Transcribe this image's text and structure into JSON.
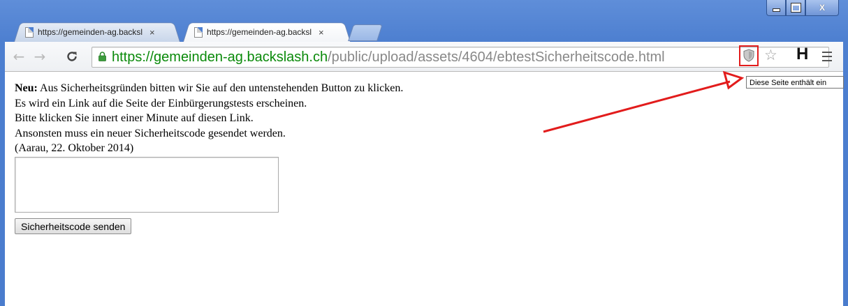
{
  "tabs": [
    {
      "title": "https://gemeinden-ag.backsl",
      "close": "×",
      "active": false
    },
    {
      "title": "https://gemeinden-ag.backsl",
      "close": "×",
      "active": true
    }
  ],
  "window_controls": {
    "close": "X"
  },
  "omnibox": {
    "scheme": "https://",
    "host": "gemeinden-ag.backslash.ch",
    "path": "/public/upload/assets/4604/ebtestSicherheitscode.html"
  },
  "toolbar": {
    "extension_letter": "H"
  },
  "tooltip": "Diese Seite enthält ein",
  "page": {
    "lead_bold": "Neu:",
    "lead_rest": " Aus Sicherheitsgründen bitten wir Sie auf den untenstehenden Button zu klicken.",
    "line2": "Es wird ein Link auf die Seite der Einbürgerungstests erscheinen.",
    "line3": "Bitte klicken Sie innert einer Minute auf diesen Link.",
    "line4": "Ansonsten muss ein neuer Sicherheitscode gesendet werden.",
    "line5": "(Aarau, 22. Oktober 2014)",
    "textarea_value": "",
    "button_label": "Sicherheitscode senden"
  },
  "colors": {
    "frame": "#4d7fd0",
    "secure_green": "#0a8a0a",
    "annotation_red": "#e21c1c"
  },
  "icons": [
    "page-icon",
    "lock-icon",
    "shield-icon",
    "star-icon",
    "menu-icon",
    "back-icon",
    "forward-icon",
    "reload-icon"
  ]
}
